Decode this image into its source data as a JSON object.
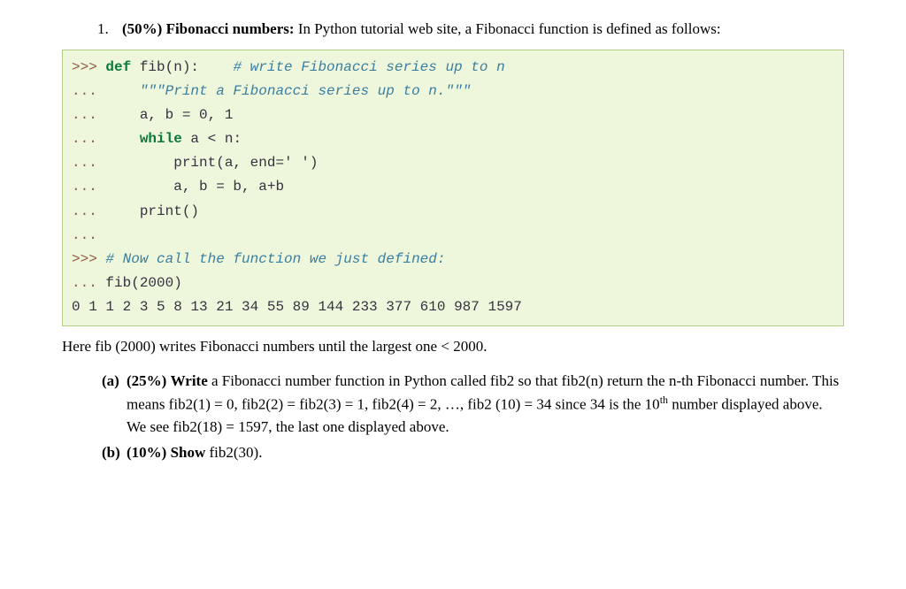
{
  "question": {
    "number": "1.",
    "weight": "(50%)",
    "title": "Fibonacci numbers:",
    "intro": " In Python tutorial web site, a Fibonacci function is defined as follows:"
  },
  "code": {
    "l1_prompt": ">>> ",
    "l1_kw": "def",
    "l1_rest": " fib(n):    ",
    "l1_comment": "# write Fibonacci series up to n",
    "l2_prompt": "...     ",
    "l2_docstring": "\"\"\"Print a Fibonacci series up to n.\"\"\"",
    "l3_prompt": "...     ",
    "l3_code": "a, b = 0, 1",
    "l4_prompt": "...     ",
    "l4_kw": "while",
    "l4_rest": " a < n:",
    "l5_prompt": "...         ",
    "l5_code": "print(a, end=' ')",
    "l6_prompt": "...         ",
    "l6_code": "a, b = b, a+b",
    "l7_prompt": "...     ",
    "l7_code": "print()",
    "l8_prompt": "...",
    "l9_prompt": ">>> ",
    "l9_comment": "# Now call the function we just defined:",
    "l10_prompt": "... ",
    "l10_code": "fib(2000)",
    "output": "0 1 1 2 3 5 8 13 21 34 55 89 144 233 377 610 987 1597"
  },
  "post_code": "Here fib (2000) writes Fibonacci numbers until the largest one < 2000.",
  "sub_a": {
    "label": "(a)",
    "weight": "(25%)",
    "verb": "Write",
    "text_before": " a Fibonacci number function in Python called fib2 so that fib2(n) return the n-th Fibonacci number. This means fib2(1) = 0, fib2(2) = fib2(3) = 1, fib2(4) = 2, …, fib2 (10) = 34 since 34 is the 10",
    "th": "th",
    "text_after": " number displayed above. We see fib2(18) = 1597, the last one displayed above."
  },
  "sub_b": {
    "label": "(b)",
    "weight": "(10%)",
    "verb": "Show",
    "text": " fib2(30)."
  }
}
